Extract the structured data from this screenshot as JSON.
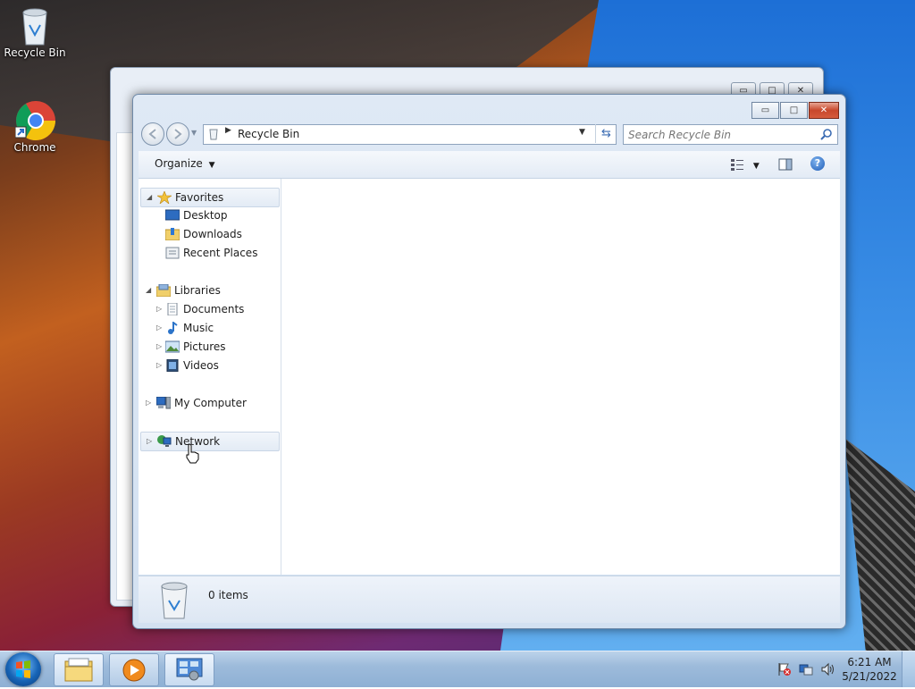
{
  "desktop": {
    "icons": [
      {
        "label": "Recycle Bin",
        "icon": "recycle-bin-icon"
      },
      {
        "label": "Chrome",
        "icon": "chrome-icon"
      }
    ]
  },
  "window": {
    "address": {
      "location": "Recycle Bin",
      "icon": "recycle-bin-icon"
    },
    "search": {
      "placeholder": "Search Recycle Bin"
    },
    "caption": {
      "minimize": "▭",
      "maximize": "□",
      "close": "✕"
    },
    "toolbar": {
      "organize": "Organize",
      "views_icon": "views-icon",
      "preview_pane_icon": "preview-pane-icon",
      "help_icon": "help-icon"
    },
    "nav": {
      "favorites": {
        "label": "Favorites",
        "items": [
          "Desktop",
          "Downloads",
          "Recent Places"
        ]
      },
      "libraries": {
        "label": "Libraries",
        "items": [
          "Documents",
          "Music",
          "Pictures",
          "Videos"
        ]
      },
      "computer": "My Computer",
      "network": "Network"
    },
    "details": {
      "count": "0 items"
    }
  },
  "taskbar": {
    "buttons": [
      "windows-explorer-icon",
      "media-player-icon",
      "control-panel-icon"
    ],
    "clock": {
      "time": "6:21 AM",
      "date": "5/21/2022"
    }
  },
  "colors": {
    "accent": "#3b6cb3",
    "close": "#c8472b",
    "taskbar": "#9dbbdb"
  }
}
